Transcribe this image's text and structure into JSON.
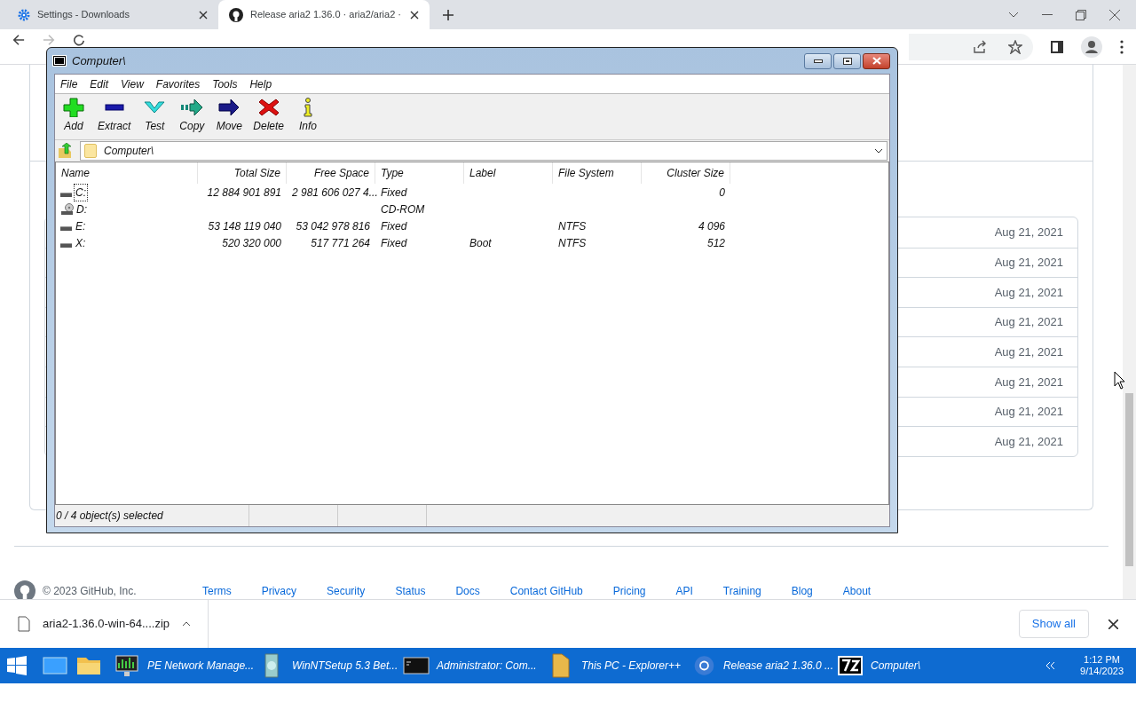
{
  "browser": {
    "tabs": [
      {
        "title": "Settings - Downloads",
        "kind": "settings",
        "selected": false
      },
      {
        "title": "Release aria2 1.36.0 · aria2/aria2 ·",
        "kind": "github",
        "selected": true
      }
    ],
    "asset_dates": [
      "Aug 21, 2021",
      "Aug 21, 2021",
      "Aug 21, 2021",
      "Aug 21, 2021",
      "Aug 21, 2021",
      "Aug 21, 2021",
      "Aug 21, 2021",
      "Aug 21, 2021"
    ],
    "footer": {
      "copyright": "© 2023 GitHub, Inc.",
      "links": [
        "Terms",
        "Privacy",
        "Security",
        "Status",
        "Docs",
        "Contact GitHub",
        "Pricing",
        "API",
        "Training",
        "Blog",
        "About"
      ]
    },
    "download_bar": {
      "file": "aria2-1.36.0-win-64....zip",
      "show_all": "Show all"
    }
  },
  "window": {
    "title": "Computer\\",
    "menu": [
      "File",
      "Edit",
      "View",
      "Favorites",
      "Tools",
      "Help"
    ],
    "toolbar": [
      {
        "label": "Add",
        "kind": "add"
      },
      {
        "label": "Extract",
        "kind": "extract"
      },
      {
        "label": "Test",
        "kind": "test"
      },
      {
        "label": "Copy",
        "kind": "copy"
      },
      {
        "label": "Move",
        "kind": "move"
      },
      {
        "label": "Delete",
        "kind": "delete"
      },
      {
        "label": "Info",
        "kind": "info"
      }
    ],
    "path": "Computer\\",
    "columns": [
      "Name",
      "Total Size",
      "Free Space",
      "Type",
      "Label",
      "File System",
      "Cluster Size"
    ],
    "rows": [
      {
        "kind": "hdd",
        "focused": true,
        "cells": [
          "C:",
          "12 884 901 891",
          "2 981 606 027 4...",
          "Fixed",
          "",
          "",
          "0"
        ]
      },
      {
        "kind": "optical",
        "focused": false,
        "cells": [
          "D:",
          "",
          "",
          "CD-ROM",
          "",
          "",
          ""
        ]
      },
      {
        "kind": "hdd",
        "focused": false,
        "cells": [
          "E:",
          "53 148 119 040",
          "53 042 978 816",
          "Fixed",
          "",
          "NTFS",
          "4 096"
        ]
      },
      {
        "kind": "hdd",
        "focused": false,
        "cells": [
          "X:",
          "520 320 000",
          "517 771 264",
          "Fixed",
          "Boot",
          "NTFS",
          "512"
        ]
      }
    ],
    "status": "0 / 4 object(s) selected"
  },
  "taskbar": {
    "apps": [
      {
        "label": "PE Network Manage...",
        "kind": "network"
      },
      {
        "label": "WinNTSetup 5.3 Bet...",
        "kind": "setup"
      },
      {
        "label": "Administrator: Com...",
        "kind": "console"
      },
      {
        "label": "This PC - Explorer++",
        "kind": "folder"
      },
      {
        "label": "Release aria2 1.36.0 ...",
        "kind": "browser"
      },
      {
        "label": "Computer\\",
        "kind": "sevenzip"
      }
    ],
    "time": "1:12 PM",
    "date": "9/14/2023"
  }
}
